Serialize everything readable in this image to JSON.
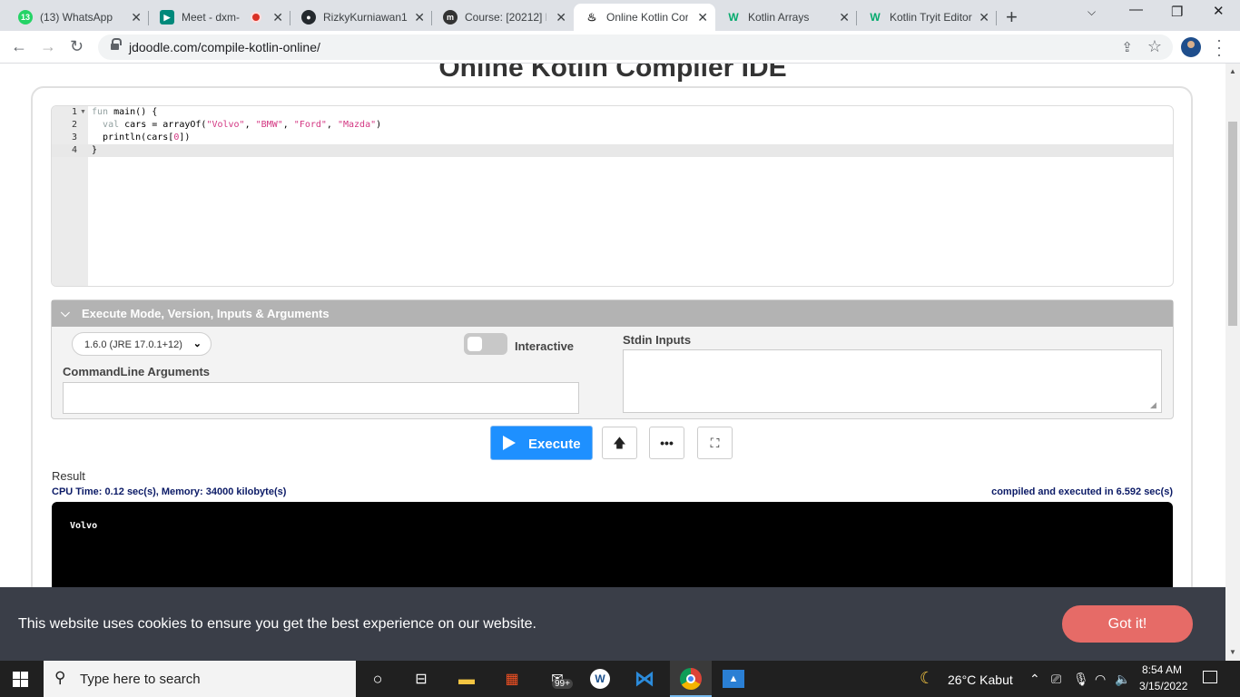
{
  "browser": {
    "tabs": [
      {
        "title": "(13) WhatsApp",
        "icon": "whatsapp-icon",
        "color": "#25d366",
        "badge": "13"
      },
      {
        "title": "Meet - dxm-",
        "icon": "google-meet-icon",
        "color": "#00897b"
      },
      {
        "title": "RizkyKurniawan1",
        "icon": "github-icon",
        "color": "#24292e"
      },
      {
        "title": "Course: [20212] P",
        "icon": "moodle-icon",
        "color": "#333333"
      },
      {
        "title": "Online Kotlin Cor",
        "icon": "jdoodle-icon",
        "color": "#222222",
        "active": true
      },
      {
        "title": "Kotlin Arrays",
        "icon": "w3schools-icon",
        "color": "#04aa6d"
      },
      {
        "title": "Kotlin Tryit Editor",
        "icon": "w3schools-icon",
        "color": "#04aa6d"
      }
    ],
    "url": "jdoodle.com/compile-kotlin-online/"
  },
  "page": {
    "title": "Online Kotlin Compiler IDE",
    "editor": {
      "line_numbers": [
        "1",
        "2",
        "3",
        "4"
      ],
      "lines": [
        [
          {
            "t": "fun ",
            "c": "kw"
          },
          {
            "t": "main() {",
            "c": ""
          }
        ],
        [
          {
            "t": "  ",
            "c": ""
          },
          {
            "t": "val",
            "c": "kw"
          },
          {
            "t": " cars = arrayOf(",
            "c": ""
          },
          {
            "t": "\"Volvo\"",
            "c": "str"
          },
          {
            "t": ", ",
            "c": ""
          },
          {
            "t": "\"BMW\"",
            "c": "str"
          },
          {
            "t": ", ",
            "c": ""
          },
          {
            "t": "\"Ford\"",
            "c": "str"
          },
          {
            "t": ", ",
            "c": ""
          },
          {
            "t": "\"Mazda\"",
            "c": "str"
          },
          {
            "t": ")",
            "c": ""
          }
        ],
        [
          {
            "t": "  println(cars[",
            "c": ""
          },
          {
            "t": "0",
            "c": "num"
          },
          {
            "t": "])",
            "c": ""
          }
        ],
        [
          {
            "t": "}",
            "c": ""
          }
        ]
      ]
    },
    "mode_panel": {
      "header": "Execute Mode, Version, Inputs & Arguments",
      "version": "1.6.0 (JRE 17.0.1+12)",
      "interactive_label": "Interactive",
      "interactive_on": false,
      "stdin_label": "Stdin Inputs",
      "stdin_value": "",
      "cmd_label": "CommandLine Arguments",
      "cmd_value": ""
    },
    "execute_label": "Execute",
    "result": {
      "label": "Result",
      "cpu_info": "CPU Time: 0.12 sec(s), Memory: 34000 kilobyte(s)",
      "compile_info": "compiled and executed in 6.592 sec(s)",
      "output": "Volvo"
    },
    "cookie": {
      "text": "This website uses cookies to ensure you get the best experience on our website.",
      "button": "Got it!"
    }
  },
  "taskbar": {
    "search_placeholder": "Type here to search",
    "mail_badge": "99+",
    "weather": "26°C  Kabut",
    "time": "8:54 AM",
    "date": "3/15/2022"
  },
  "colors": {
    "accent": "#1e90ff",
    "cookie_button": "#e66b67",
    "panel_header": "#b3b3b3"
  }
}
